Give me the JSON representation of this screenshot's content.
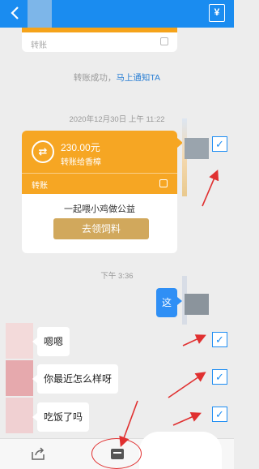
{
  "header": {
    "back_icon": "back-arrow-icon",
    "pay_icon_label": "¥"
  },
  "previous_transfer": {
    "label": "转账"
  },
  "notice": {
    "text": "转账成功，",
    "link": "马上通知TA"
  },
  "timestamps": {
    "first": "2020年12月30日 上午 11:22",
    "second": "下午 3:36"
  },
  "transfer": {
    "amount": "230.00元",
    "to": "转账给香樟",
    "label": "转账",
    "promo_text": "一起喂小鸡做公益",
    "promo_button": "去领饲料"
  },
  "messages": [
    {
      "sender": "self",
      "text": "这"
    },
    {
      "sender": "other",
      "text": "嗯嗯"
    },
    {
      "sender": "other",
      "text": "你最近怎么样呀"
    },
    {
      "sender": "other",
      "text": "吃饭了吗"
    }
  ],
  "checkbox_mark": "✓",
  "bottom_bar": {
    "share_icon": "share-icon",
    "favorite_icon": "favorite-icon"
  },
  "colors": {
    "topbar": "#1a8cf0",
    "transfer": "#f6a623",
    "checkbox": "#1f8ef3",
    "annotation": "#e03030"
  }
}
